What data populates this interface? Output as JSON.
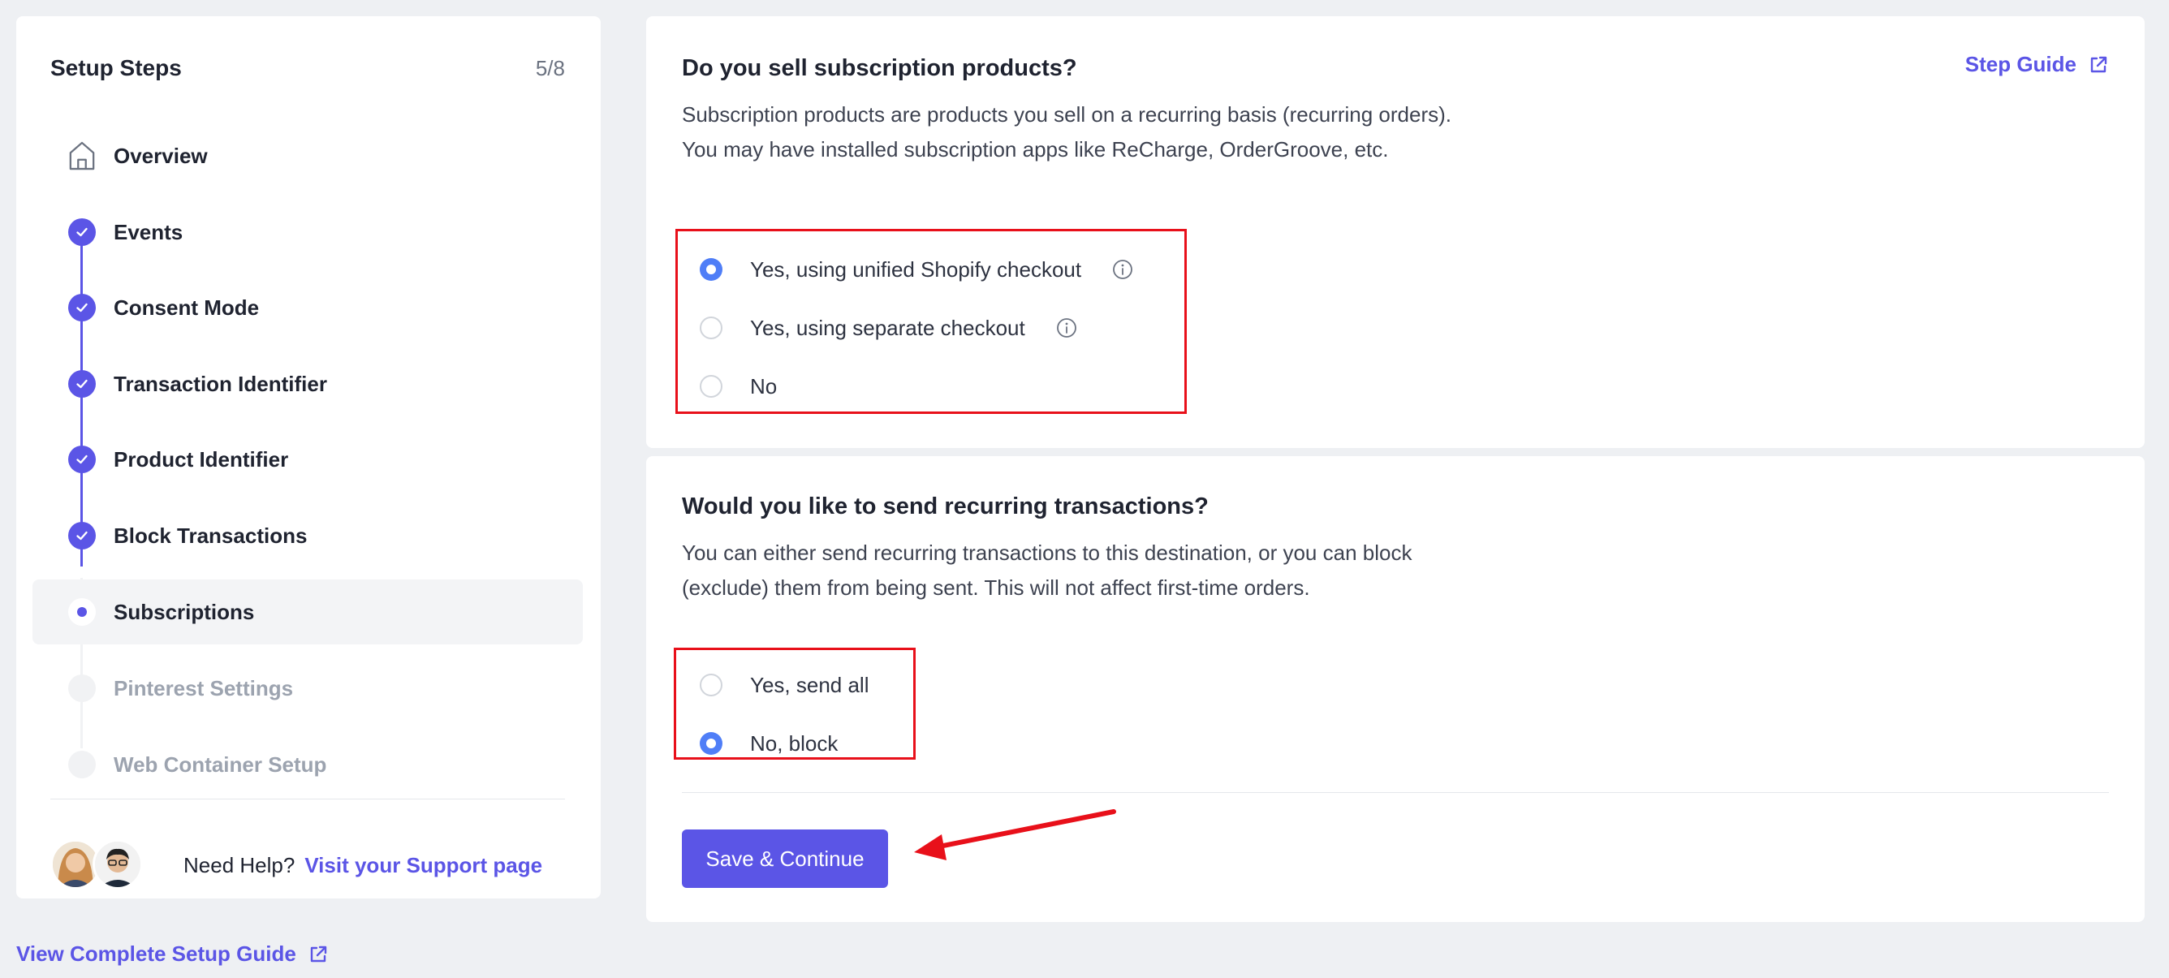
{
  "sidebar": {
    "title": "Setup Steps",
    "progress": "5/8",
    "steps": [
      {
        "label": "Overview",
        "state": "home"
      },
      {
        "label": "Events",
        "state": "done"
      },
      {
        "label": "Consent Mode",
        "state": "done"
      },
      {
        "label": "Transaction Identifier",
        "state": "done"
      },
      {
        "label": "Product Identifier",
        "state": "done"
      },
      {
        "label": "Block Transactions",
        "state": "done"
      },
      {
        "label": "Subscriptions",
        "state": "current"
      },
      {
        "label": "Pinterest Settings",
        "state": "pending"
      },
      {
        "label": "Web Container Setup",
        "state": "pending"
      }
    ],
    "help_text": "Need Help?",
    "help_link": "Visit your Support page"
  },
  "footer": {
    "guide_link": "View Complete Setup Guide"
  },
  "card1": {
    "title": "Do you sell subscription products?",
    "description": "Subscription products are products you sell on a recurring basis (recurring orders). You may have installed subscription apps like ReCharge, OrderGroove, etc.",
    "step_guide": "Step Guide",
    "options": [
      {
        "label": "Yes, using unified Shopify checkout",
        "checked": true
      },
      {
        "label": "Yes, using separate checkout",
        "checked": false
      },
      {
        "label": "No",
        "checked": false
      }
    ]
  },
  "card2": {
    "title": "Would you like to send recurring transactions?",
    "description": "You can either send recurring transactions to this destination, or you can block (exclude) them from being sent. This will not affect first-time orders.",
    "options": [
      {
        "label": "Yes, send all",
        "checked": false
      },
      {
        "label": "No, block",
        "checked": true
      }
    ],
    "save_label": "Save & Continue"
  },
  "colors": {
    "accent": "#5b55e6",
    "radio_checked": "#4f7ef7",
    "highlight": "#e8101a"
  }
}
